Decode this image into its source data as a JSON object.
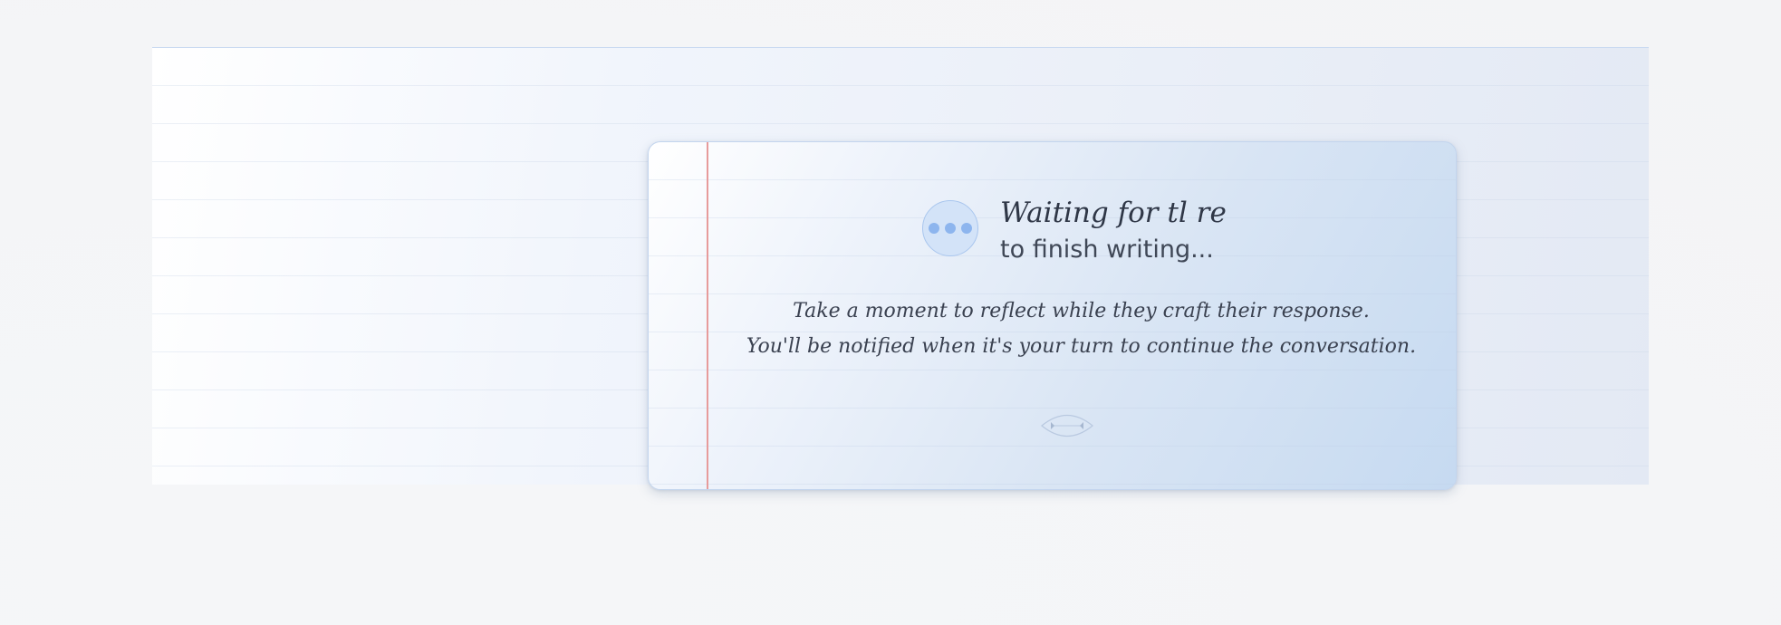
{
  "waiting": {
    "title": "Waiting for tl re",
    "subtitle": "to finish writing...",
    "message_line1": "Take a moment to reflect while they craft their response.",
    "message_line2": "You'll be notified when it's your turn to continue the conversation."
  },
  "icons": {
    "typing_indicator": "typing-dots-icon",
    "ornament": "flourish-divider-icon"
  },
  "colors": {
    "accent": "#8db5ee",
    "margin_line": "#e79b9b",
    "text": "#2f3747"
  }
}
